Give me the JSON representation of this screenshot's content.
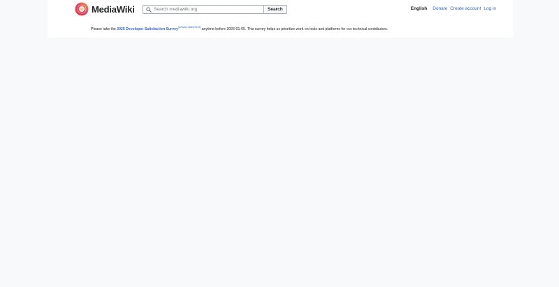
{
  "header": {
    "logo_text": "MediaWiki",
    "search": {
      "placeholder": "Search mediawiki.org",
      "button_label": "Search"
    },
    "nav": {
      "language": "English",
      "donate": "Donate",
      "create_account": "Create account",
      "log_in": "Log in"
    }
  },
  "notice": {
    "prefix": "Please take the ",
    "survey_link": "2025 Developer Satisfaction Survey",
    "privacy_bracket_open": "(",
    "privacy_link": "privacy statement",
    "privacy_bracket_close": ")",
    "suffix": " anytime before 2026-01-05. This survey helps us prioritize work on tools and platforms for our technical contributors."
  },
  "colors": {
    "link": "#3366cc",
    "text": "#202122",
    "page_background": "#f8f9fa"
  }
}
